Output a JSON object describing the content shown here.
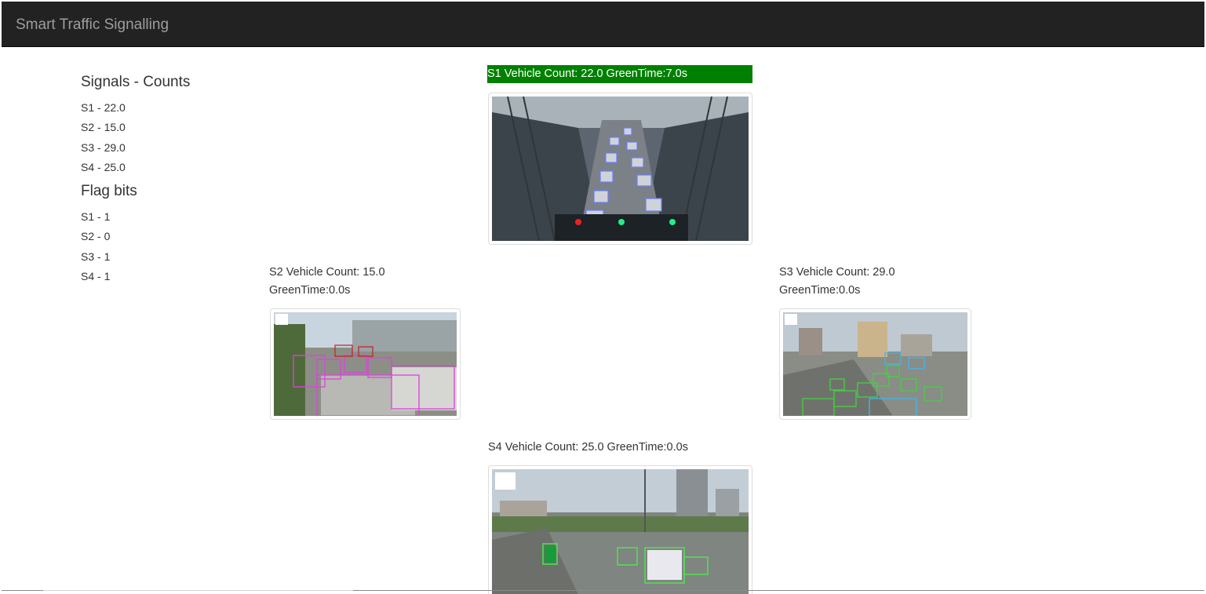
{
  "navbar": {
    "brand": "Smart Traffic Signalling"
  },
  "sidebar": {
    "counts_title": "Signals - Counts",
    "counts": [
      "S1 - 22.0",
      "S2 - 15.0",
      "S3 - 29.0",
      "S4 - 25.0"
    ],
    "flags_title": "Flag bits",
    "flags": [
      "S1 - 1",
      "S2 - 0",
      "S3 - 1",
      "S4 - 1"
    ]
  },
  "signals": {
    "s1": {
      "label": "S1 Vehicle Count: 22.0 GreenTime:7.0s",
      "active": true,
      "image": "bridge-traffic-camera-image"
    },
    "s2": {
      "label_line1": "S2 Vehicle Count: 15.0",
      "label_line2": "GreenTime:0.0s",
      "active": false,
      "image": "street-cars-detection-image"
    },
    "s3": {
      "label_line1": "S3 Vehicle Count: 29.0",
      "label_line2": "GreenTime:0.0s",
      "active": false,
      "image": "highway-vehicle-detection-image"
    },
    "s4": {
      "label": "S4 Vehicle Count: 25.0 GreenTime:0.0s",
      "active": false,
      "image": "city-junction-detection-image"
    }
  },
  "colors": {
    "navbar_bg": "#222222",
    "brand_text": "#9d9d9d",
    "active_label_bg": "#008000",
    "active_label_text": "#ffffff"
  }
}
